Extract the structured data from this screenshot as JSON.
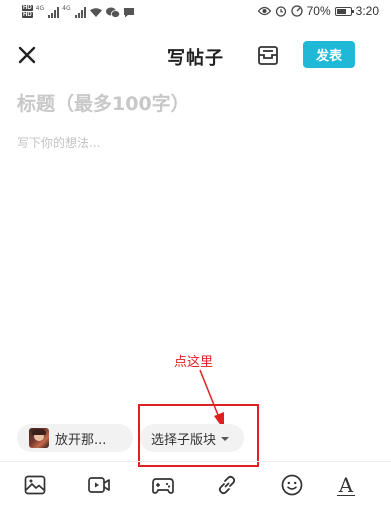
{
  "status_bar": {
    "net1": "4G",
    "net2": "4G",
    "battery": "70%",
    "battery_level": 0.7,
    "time": "3:20"
  },
  "header": {
    "title": "写帖子",
    "publish_label": "发表"
  },
  "editor": {
    "title_placeholder": "标题（最多100字）",
    "body_placeholder": "写下你的想法..."
  },
  "annotation": {
    "text": "点这里",
    "color": "#e02020"
  },
  "chips": {
    "game_name": "放开那...",
    "subforum_label": "选择子版块"
  },
  "toolbar": {
    "icons": [
      "image-icon",
      "video-icon",
      "gamepad-icon",
      "link-icon",
      "emoji-icon",
      "text-format-icon"
    ],
    "format_glyph": "A"
  },
  "colors": {
    "accent": "#1fb8d6"
  }
}
